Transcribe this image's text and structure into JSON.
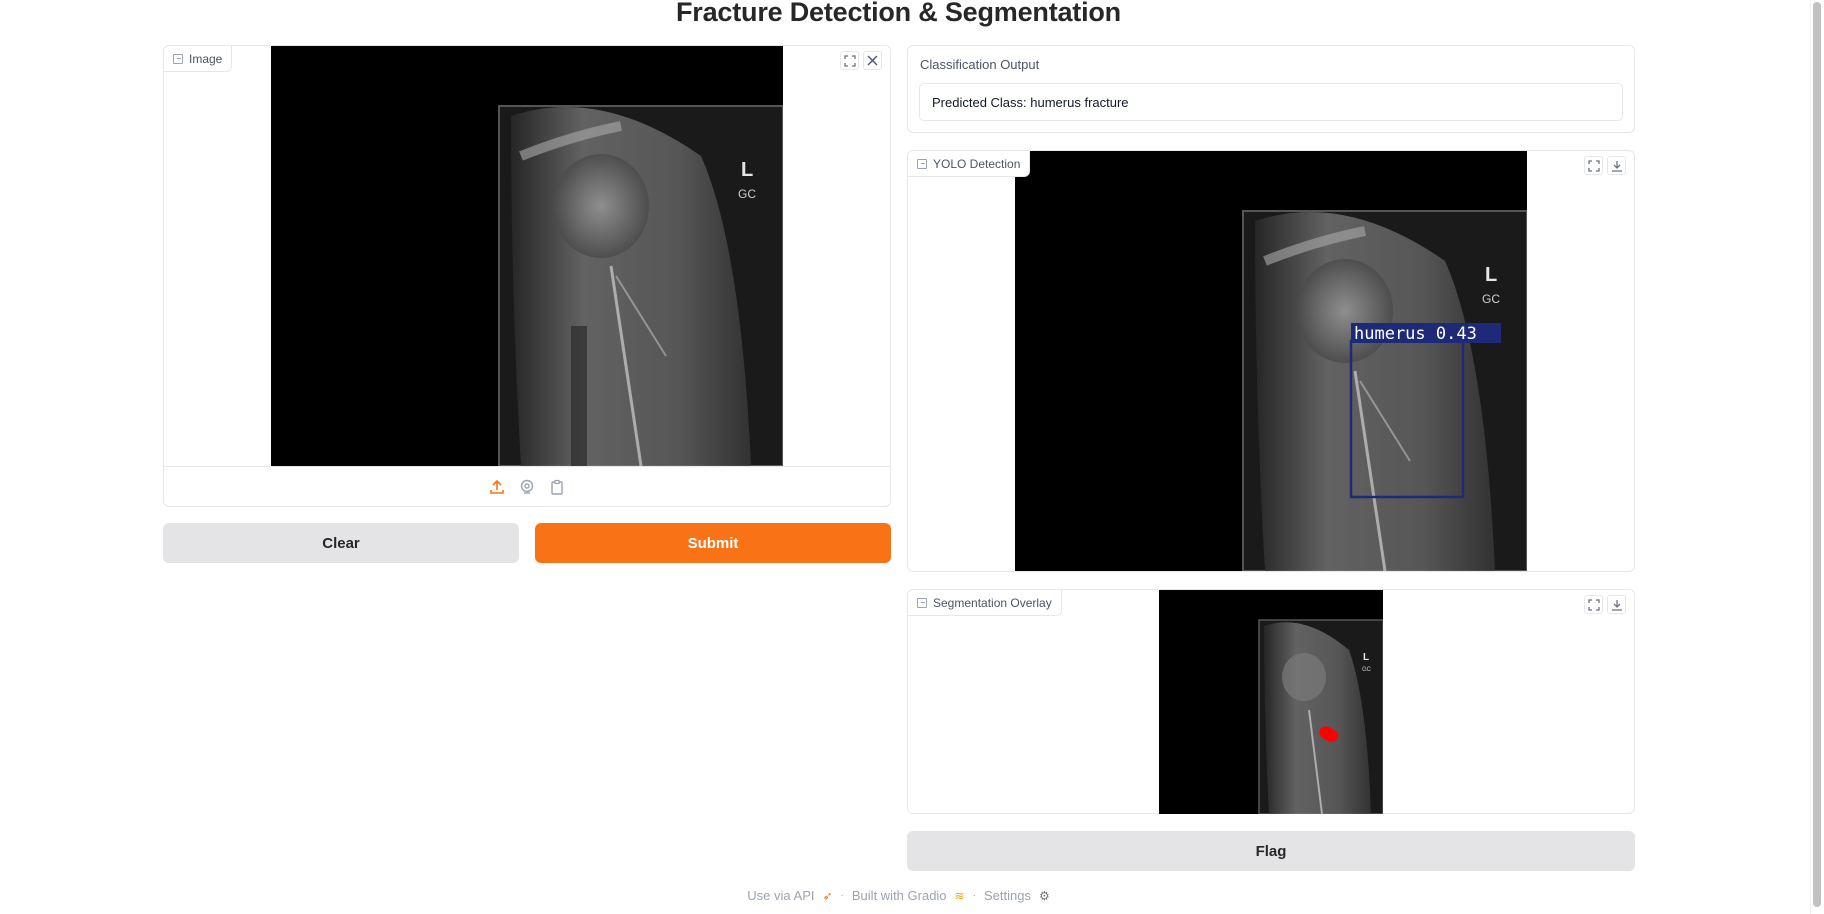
{
  "page": {
    "title": "Fracture Detection & Segmentation"
  },
  "input_image": {
    "label": "Image",
    "source_options": [
      "upload-icon",
      "webcam-icon",
      "clipboard-icon"
    ]
  },
  "buttons": {
    "clear": "Clear",
    "submit": "Submit",
    "flag": "Flag"
  },
  "classification": {
    "label": "Classification Output",
    "value": "Predicted Class: humerus fracture"
  },
  "yolo": {
    "label": "YOLO Detection",
    "detection_label": "humerus 0.43",
    "box_color": "#1e2a78"
  },
  "segmentation": {
    "label": "Segmentation Overlay",
    "mask_color": "#ff0000"
  },
  "xray_marker": {
    "letter": "L",
    "initials": "GC"
  },
  "footer": {
    "api": "Use via API",
    "built": "Built with Gradio",
    "settings": "Settings"
  },
  "colors": {
    "accent": "#f97316",
    "secondary": "#e4e4e7"
  }
}
